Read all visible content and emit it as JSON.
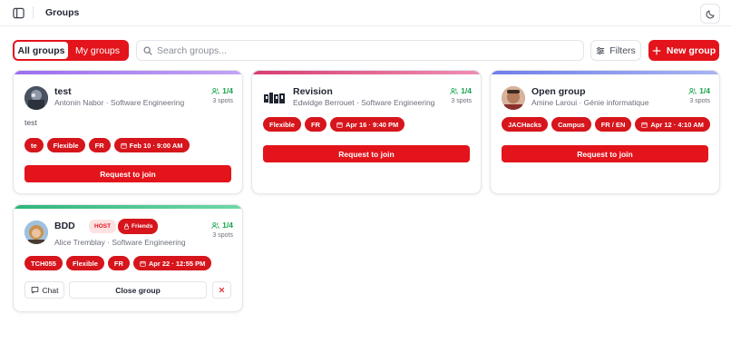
{
  "header": {
    "title": "Groups",
    "sidebar_icon": "sidebar-icon",
    "theme_icon": "moon-icon"
  },
  "toolbar": {
    "tabs": [
      {
        "label": "All groups",
        "active": true
      },
      {
        "label": "My groups",
        "active": false
      }
    ],
    "search_placeholder": "Search groups...",
    "search_value": "",
    "filters_label": "Filters",
    "new_group_label": "New group"
  },
  "colors": {
    "accent": "#e3141b",
    "spots": "#16a34a",
    "bar_purple": "#a77ce8",
    "bar_pink": "#e25a8a",
    "bar_blue": "#7f8ff0",
    "bar_green": "#3dbf86"
  },
  "cards": [
    {
      "title": "test",
      "owner": "Antonin Nabor",
      "program": "Software Engineering",
      "spots": "1/4",
      "spots_label": "3 spots",
      "description": "test",
      "tags": [
        "te",
        "Flexible",
        "FR"
      ],
      "date": "Feb 10 · 9:00 AM",
      "action_label": "Request to join"
    },
    {
      "title": "Revision",
      "owner": "Edwidge Berrouet",
      "program": "Software Engineering",
      "spots": "1/4",
      "spots_label": "3 spots",
      "tags": [
        "Flexible",
        "FR"
      ],
      "date": "Apr 16 · 9:40 PM",
      "action_label": "Request to join"
    },
    {
      "title": "Open group",
      "owner": "Amine Laroui",
      "program": "Génie informatique",
      "spots": "1/4",
      "spots_label": "3 spots",
      "tags": [
        "JACHacks",
        "Campus",
        "FR / EN"
      ],
      "date": "Apr 12 · 4:10 AM",
      "action_label": "Request to join"
    },
    {
      "title": "BDD",
      "host_badge": "HOST",
      "friends_badge": "Friends",
      "owner": "Alice Tremblay",
      "program": "Software Engineering",
      "spots": "1/4",
      "spots_label": "3 spots",
      "tags": [
        "TCH055",
        "Flexible",
        "FR"
      ],
      "date": "Apr 22 · 12:55 PM",
      "chat_label": "Chat",
      "close_label": "Close group"
    }
  ]
}
